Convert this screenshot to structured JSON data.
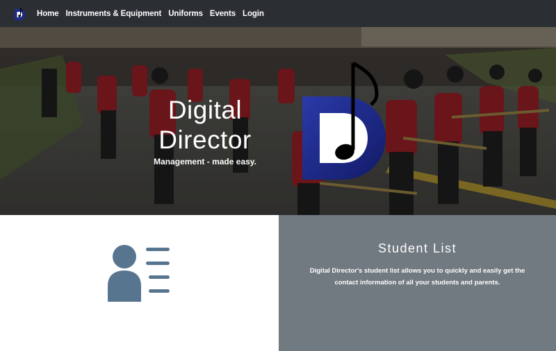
{
  "nav": {
    "brand_icon": "digital-director-logo-icon",
    "links": [
      "Home",
      "Instruments & Equipment",
      "Uniforms",
      "Events",
      "Login"
    ]
  },
  "hero": {
    "title_line1": "Digital",
    "title_line2": "Director",
    "tagline": "Management - made easy.",
    "background": "marching band parade photo",
    "logo_icon": "digital-director-logo-icon"
  },
  "feature": {
    "icon": "student-list-icon",
    "title": "Student List",
    "description": "Digital Director's student list allows you to quickly and easily get the contact information of all your students and parents."
  },
  "colors": {
    "navbar": "#2b2f33",
    "feature_panel": "#717981",
    "icon_slate": "#587590",
    "logo_blue": "#1e2a8c"
  }
}
